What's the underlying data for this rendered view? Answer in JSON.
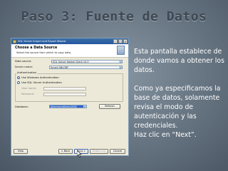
{
  "slide": {
    "title": "Paso 3: Fuente de Datos",
    "body": {
      "para1": "Esta pantalla establece de donde vamos a obtener los datos.",
      "para2a": "Como ya especificamos la base de datos, solamente revisa el modo de autenticación y las credenciales.",
      "para2b": "Haz clic en “Next”."
    }
  },
  "wizard": {
    "window_title": "SQL Server Import and Export Wizard",
    "header_title": "Choose a Data Source",
    "header_subtitle": "Select the source from which to copy data.",
    "data_source_label": "Data source:",
    "data_source_value": "SQL Server Native Client 10.0",
    "server_name_label": "Server name:",
    "server_name_value": "Smart-SNLOBY",
    "auth_group_label": "Authentication",
    "windows_auth_label": "Use Windows Authentication",
    "sql_auth_label": "Use SQL Server Authentication",
    "user_name_label": "User name:",
    "password_label": "Password:",
    "database_label": "Database:",
    "database_value": "AdventureWorks2008",
    "refresh_label": "Refresh",
    "help_label": "Help",
    "back_label": "< Back",
    "next_label": "Next >",
    "finish_label": "Finish >>|",
    "cancel_label": "Cancel"
  },
  "colors": {
    "title": "#3e4852",
    "body_text": "#ffffff",
    "slide_bg": "#6b7986",
    "selection": "#2f63c9"
  }
}
